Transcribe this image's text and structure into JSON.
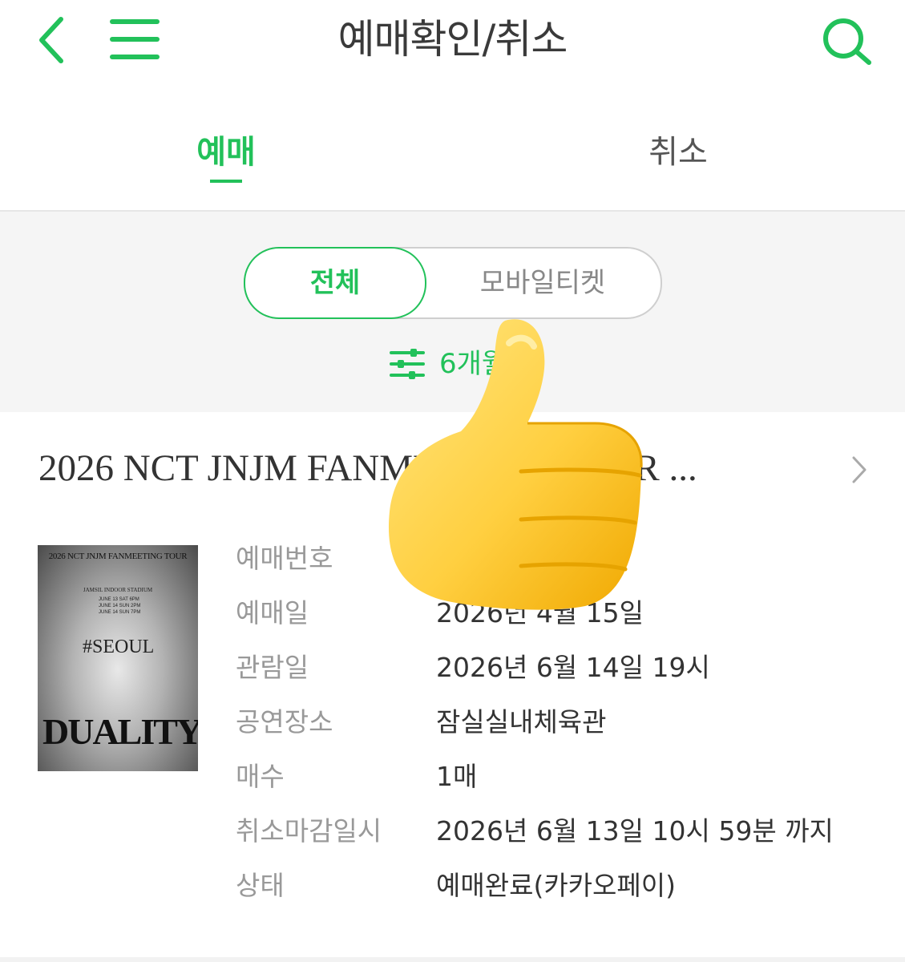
{
  "header": {
    "title": "예매확인/취소",
    "back_icon": "chevron-left-icon",
    "menu_icon": "hamburger-menu-icon",
    "search_icon": "search-icon",
    "accent_color": "#22c15a"
  },
  "tabs": [
    {
      "label": "예매",
      "active": true
    },
    {
      "label": "취소",
      "active": false
    }
  ],
  "filter": {
    "segments": [
      {
        "label": "전체",
        "active": true
      },
      {
        "label": "모바일티켓",
        "active": false
      }
    ],
    "period_label": "6개월",
    "period_icon": "sliders-icon"
  },
  "booking": {
    "event_title": "2026 NCT JNJM FANMEETING TOUR ...",
    "poster": {
      "top_text": "2026 NCT JNJM FANMEETING TOUR",
      "venue": "JAMSIL INDOOR STADIUM",
      "dates": [
        "JUNE 13 SAT 6PM",
        "JUNE 14 SUN 2PM",
        "JUNE 14 SUN 7PM"
      ],
      "city": "#SEOUL",
      "logo": "DUALITY"
    },
    "details": [
      {
        "label": "예매번호",
        "value": ""
      },
      {
        "label": "예매일",
        "value": "2026년 4월 15일"
      },
      {
        "label": "관람일",
        "value": "2026년 6월 14일 19시"
      },
      {
        "label": "공연장소",
        "value": "잠실실내체육관"
      },
      {
        "label": "매수",
        "value": "1매"
      },
      {
        "label": "취소마감일시",
        "value": "2026년 6월 13일 10시 59분 까지"
      },
      {
        "label": "상태",
        "value": "예매완료(카카오페이)"
      }
    ]
  },
  "overlay": {
    "icon": "thumbs-up-emoji"
  }
}
